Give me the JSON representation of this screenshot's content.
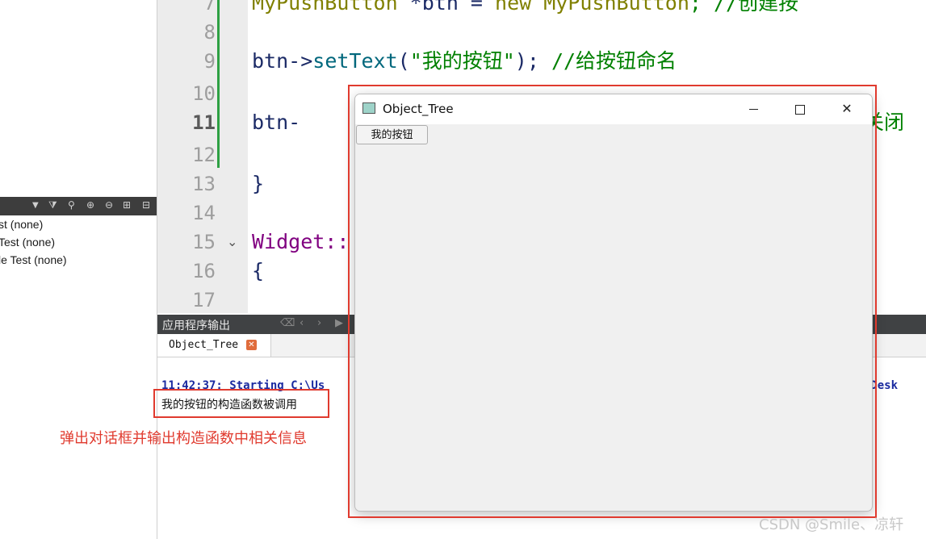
{
  "tree_items": [
    "st (none)",
    " Test (none)",
    "le Test (none)"
  ],
  "toolbar_icons": [
    "filter-icon",
    "sync-icon",
    "expand-icon",
    "collapse-icon",
    "split-icon",
    "close-pane-icon"
  ],
  "editor": {
    "line_numbers": [
      "7",
      "8",
      "9",
      "10",
      "11",
      "12",
      "13",
      "14",
      "15",
      "16",
      "17"
    ],
    "current_line": "11",
    "line7": {
      "a": "MyPushButton ",
      "b": "*btn = ",
      "c": "new ",
      "d": "MyPushButton",
      "e": "; //创建按"
    },
    "line9": {
      "a": "btn->",
      "b": "setText",
      "c": "(",
      "d": "\"我的按钮\"",
      "e": "); ",
      "f": "//给按钮命名"
    },
    "line11": {
      "a": "btn-",
      "b": "加关闭"
    },
    "line13": "}",
    "line15": "Widget::",
    "line16": "{"
  },
  "output": {
    "panel_title": "应用程序输出",
    "tab_label": "Object_Tree",
    "log_line": "11:42:37: Starting C:\\Us",
    "log_tail": "ee-Desk",
    "constructor_msg": "我的按钮的构造函数被调用"
  },
  "annotation": "弹出对话框并输出构造函数中相关信息",
  "dialog": {
    "title": "Object_Tree",
    "button_label": "我的按钮",
    "close_glyph": "✕"
  },
  "watermark": "CSDN @Smile、凉轩",
  "colors": {
    "highlight_frame": "#e03a2e",
    "change_bar": "#2ea043"
  }
}
